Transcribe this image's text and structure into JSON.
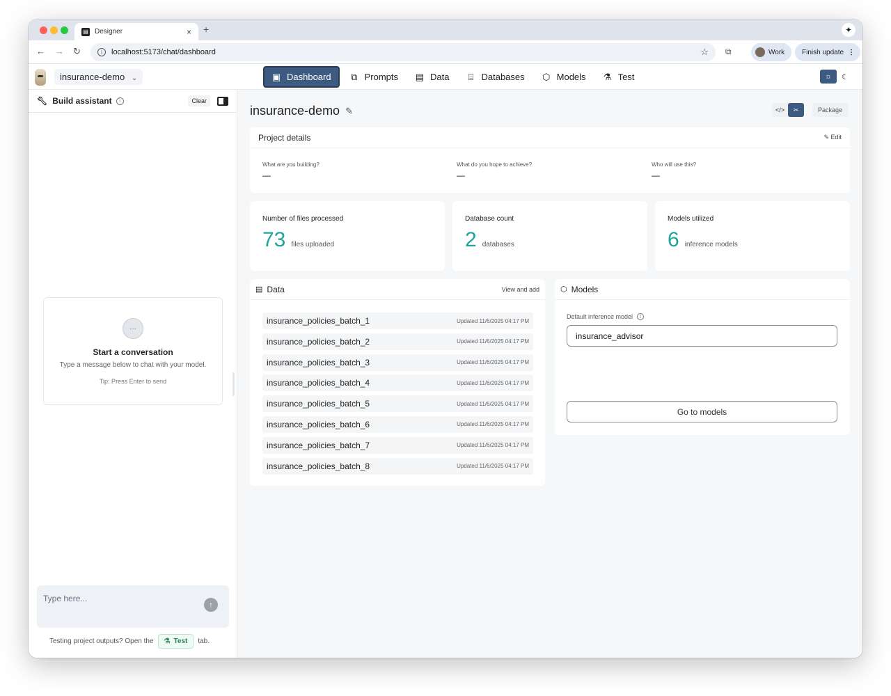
{
  "browser": {
    "tab_title": "Designer",
    "tab_close": "×",
    "new_tab": "+",
    "url": "localhost:5173/chat/dashboard",
    "profile_label": "Work",
    "finish_update_label": "Finish update",
    "icons": [
      "back-icon",
      "forward-icon",
      "reload-icon",
      "star-icon",
      "cast-icon",
      "spark-icon"
    ]
  },
  "app": {
    "project_name": "insurance-demo",
    "nav": [
      {
        "label": "Dashboard",
        "icon": "dashboard-icon",
        "active": true
      },
      {
        "label": "Prompts",
        "icon": "prompts-icon"
      },
      {
        "label": "Data",
        "icon": "data-icon"
      },
      {
        "label": "Databases",
        "icon": "databases-icon"
      },
      {
        "label": "Models",
        "icon": "models-icon"
      },
      {
        "label": "Test",
        "icon": "flask-icon"
      }
    ],
    "theme": {
      "selected": "light"
    }
  },
  "sidebar": {
    "title": "Build assistant",
    "clear_label": "Clear",
    "empty_title": "Start a conversation",
    "empty_sub": "Type a message below to chat with your model.",
    "empty_tip": "Tip: Press Enter to send",
    "input_placeholder": "Type here...",
    "testing_prefix": "Testing project outputs? Open the",
    "testing_button": "Test",
    "testing_suffix": "tab."
  },
  "main": {
    "title": "insurance-demo",
    "package_label": "Package",
    "project_details": {
      "title": "Project details",
      "edit_label": "Edit",
      "questions": [
        {
          "q": "What are you building?",
          "a": "—"
        },
        {
          "q": "What do you hope to achieve?",
          "a": "—"
        },
        {
          "q": "Who will use this?",
          "a": "—"
        }
      ]
    },
    "stats": [
      {
        "label": "Number of files processed",
        "value": "73",
        "unit": "files uploaded"
      },
      {
        "label": "Database count",
        "value": "2",
        "unit": "databases"
      },
      {
        "label": "Models utilized",
        "value": "6",
        "unit": "inference models"
      }
    ],
    "data": {
      "title": "Data",
      "view_add_label": "View and add",
      "rows": [
        {
          "name": "insurance_policies_batch_1",
          "updated": "Updated 11/6/2025 04:17 PM"
        },
        {
          "name": "insurance_policies_batch_2",
          "updated": "Updated 11/6/2025 04:17 PM"
        },
        {
          "name": "insurance_policies_batch_3",
          "updated": "Updated 11/6/2025 04:17 PM"
        },
        {
          "name": "insurance_policies_batch_4",
          "updated": "Updated 11/6/2025 04:17 PM"
        },
        {
          "name": "insurance_policies_batch_5",
          "updated": "Updated 11/6/2025 04:17 PM"
        },
        {
          "name": "insurance_policies_batch_6",
          "updated": "Updated 11/6/2025 04:17 PM"
        },
        {
          "name": "insurance_policies_batch_7",
          "updated": "Updated 11/6/2025 04:17 PM"
        },
        {
          "name": "insurance_policies_batch_8",
          "updated": "Updated 11/6/2025 04:17 PM"
        }
      ]
    },
    "models": {
      "title": "Models",
      "default_label": "Default inference model",
      "default_value": "insurance_advisor",
      "goto_label": "Go to models"
    }
  },
  "colors": {
    "accent": "#3d5a80",
    "stat": "#1fa59a"
  }
}
